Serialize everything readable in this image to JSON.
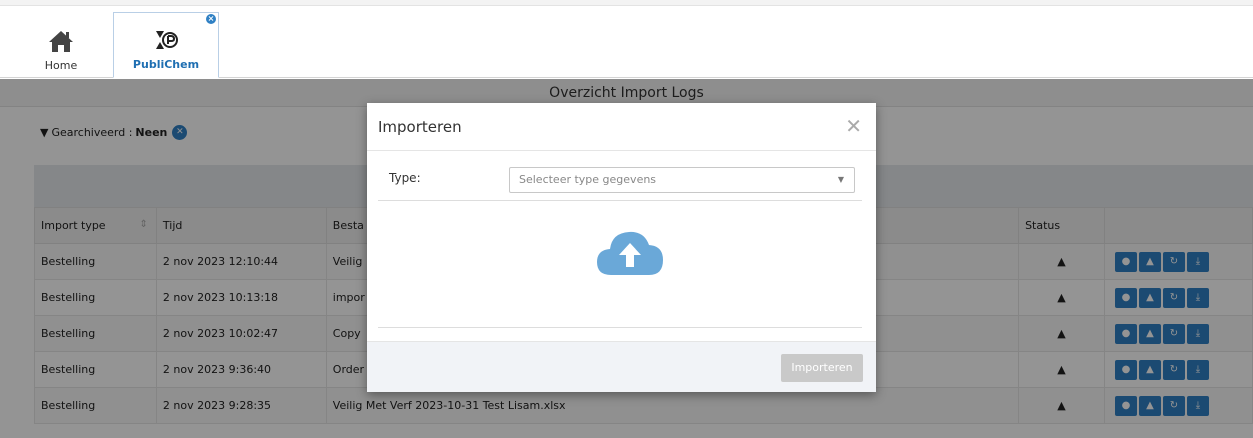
{
  "tabs": [
    {
      "label": "Home"
    },
    {
      "label": "PubliChem"
    }
  ],
  "page": {
    "title": "Overzicht Import Logs",
    "filter_label": "Gearchiveerd :",
    "filter_value": "Neen"
  },
  "table": {
    "columns": [
      "Import type",
      "Tijd",
      "Besta",
      "Status"
    ],
    "rows": [
      {
        "type": "Bestelling",
        "time": "2 nov 2023 12:10:44",
        "file": "Veilig"
      },
      {
        "type": "Bestelling",
        "time": "2 nov 2023 10:13:18",
        "file": "impor"
      },
      {
        "type": "Bestelling",
        "time": "2 nov 2023 10:02:47",
        "file": "Copy"
      },
      {
        "type": "Bestelling",
        "time": "2 nov 2023 9:36:40",
        "file": "Order"
      },
      {
        "type": "Bestelling",
        "time": "2 nov 2023 9:28:35",
        "file": "Veilig Met Verf 2023-10-31 Test Lisam.xlsx"
      }
    ]
  },
  "modal": {
    "title": "Importeren",
    "type_label": "Type:",
    "type_placeholder": "Selecteer type gegevens",
    "import_button": "Importeren"
  },
  "colors": {
    "accent": "#2f80c4",
    "cloud": "#6aa8d8"
  }
}
